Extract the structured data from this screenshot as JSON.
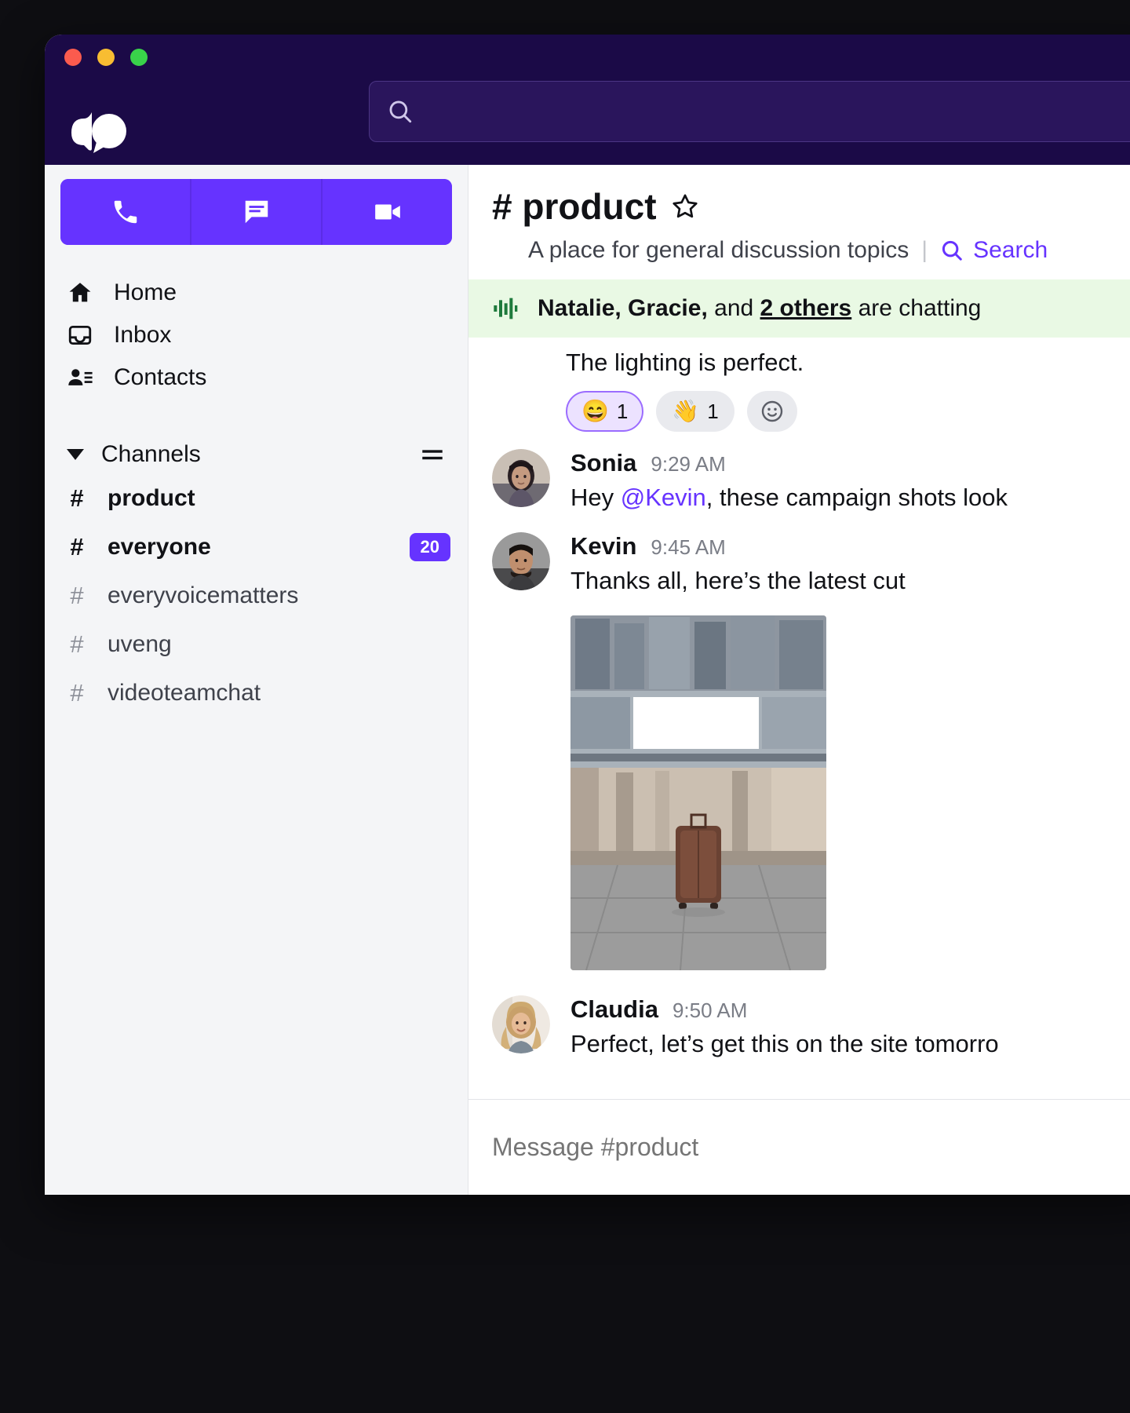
{
  "window": {
    "traffic_lights": [
      "close",
      "minimize",
      "maximize"
    ],
    "logo": "speech-bubbles-logo"
  },
  "search": {
    "placeholder": "",
    "value": "",
    "icon": "search-icon"
  },
  "sidebar": {
    "quick_actions": [
      {
        "name": "call",
        "icon": "phone-icon"
      },
      {
        "name": "message",
        "icon": "chat-bubble-icon"
      },
      {
        "name": "video",
        "icon": "video-camera-icon"
      }
    ],
    "nav": [
      {
        "label": "Home",
        "icon": "home-icon"
      },
      {
        "label": "Inbox",
        "icon": "inbox-icon"
      },
      {
        "label": "Contacts",
        "icon": "contacts-icon"
      }
    ],
    "channels_header": {
      "label": "Channels",
      "caret": "caret-down-icon",
      "menu_icon": "list-menu-icon"
    },
    "channels": [
      {
        "name": "product",
        "hash": "#",
        "unread": true,
        "badge": null
      },
      {
        "name": "everyone",
        "hash": "#",
        "unread": true,
        "badge": "20"
      },
      {
        "name": "everyvoicematters",
        "hash": "#",
        "unread": false,
        "badge": null
      },
      {
        "name": "uveng",
        "hash": "#",
        "unread": false,
        "badge": null
      },
      {
        "name": "videoteamchat",
        "hash": "#",
        "unread": false,
        "badge": null
      }
    ]
  },
  "channel": {
    "hash": "#",
    "name": "product",
    "title": "# product",
    "star_icon": "star-outline-icon",
    "topic": "A place for general discussion topics",
    "divider": "|",
    "search_link": "Search",
    "search_icon": "search-icon"
  },
  "chatting_banner": {
    "icon": "audio-waveform-icon",
    "names": "Natalie, Gracie,",
    "and": " and ",
    "others": "2 others",
    "suffix": " are chatting"
  },
  "messages": {
    "previous_tail": {
      "text": "The lighting is perfect.",
      "reactions": [
        {
          "emoji": "😄",
          "count": "1",
          "active": true,
          "name": "grin-reaction"
        },
        {
          "emoji": "👋",
          "count": "1",
          "active": false,
          "name": "wave-reaction"
        },
        {
          "emoji": "",
          "count": "",
          "active": false,
          "name": "add-reaction"
        }
      ]
    },
    "list": [
      {
        "author": "Sonia",
        "time": "9:29 AM",
        "avatar": "sonia-avatar",
        "text_before": "Hey ",
        "mention": "@Kevin",
        "text_after": ", these campaign shots look",
        "attachment": null
      },
      {
        "author": "Kevin",
        "time": "9:45 AM",
        "avatar": "kevin-avatar",
        "text_before": "Thanks all, here’s the latest cut",
        "mention": "",
        "text_after": "",
        "attachment": "suitcase-plaza-photo"
      },
      {
        "author": "Claudia",
        "time": "9:50 AM",
        "avatar": "claudia-avatar",
        "text_before": "Perfect, let’s get this on the site tomorro",
        "mention": "",
        "text_after": "",
        "attachment": null
      }
    ]
  },
  "composer": {
    "placeholder": "Message #product",
    "value": ""
  },
  "colors": {
    "brand_purple": "#6633ff",
    "titlebar": "#1b0a47",
    "sidebar_bg": "#f4f5f7",
    "banner_green": "#e9f9e4",
    "mention": "#6633ff",
    "badge": "#6633ff"
  }
}
